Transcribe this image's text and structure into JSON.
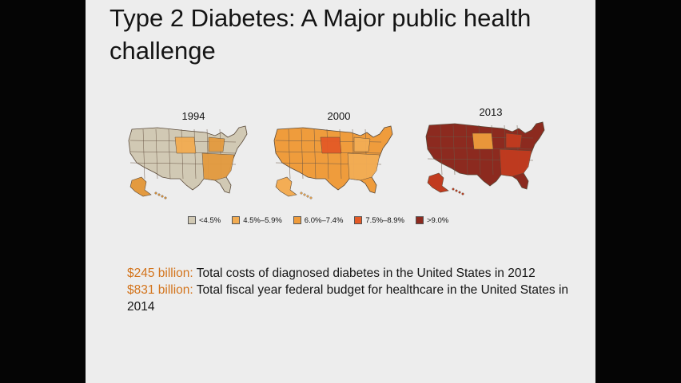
{
  "slide": {
    "title": "Type 2 Diabetes: A Major public health\nchallenge"
  },
  "maps": [
    {
      "year": "1994",
      "main_color": "#d1c9b4",
      "secondary_color": "#e39a3f",
      "accent_color": "#f2ac52"
    },
    {
      "year": "2000",
      "main_color": "#ef9c3c",
      "secondary_color": "#f3ad55",
      "accent_color": "#e45a26"
    },
    {
      "year": "2013",
      "main_color": "#8c2a1f",
      "secondary_color": "#c13b1f",
      "accent_color": "#ef9c3c"
    }
  ],
  "legend": [
    {
      "label": "<4.5%",
      "color": "#d1c9b4"
    },
    {
      "label": "4.5%–5.9%",
      "color": "#f2ac52"
    },
    {
      "label": "6.0%–7.4%",
      "color": "#ef9c3c"
    },
    {
      "label": "7.5%–8.9%",
      "color": "#e45a26"
    },
    {
      "label": ">9.0%",
      "color": "#8c2a1f"
    }
  ],
  "facts": [
    {
      "amount": "$245 billion:",
      "text": " Total costs of diagnosed diabetes in the United States in 2012"
    },
    {
      "amount": "$831 billion:",
      "text": " Total fiscal year federal budget for healthcare in the United States in 2014"
    }
  ]
}
